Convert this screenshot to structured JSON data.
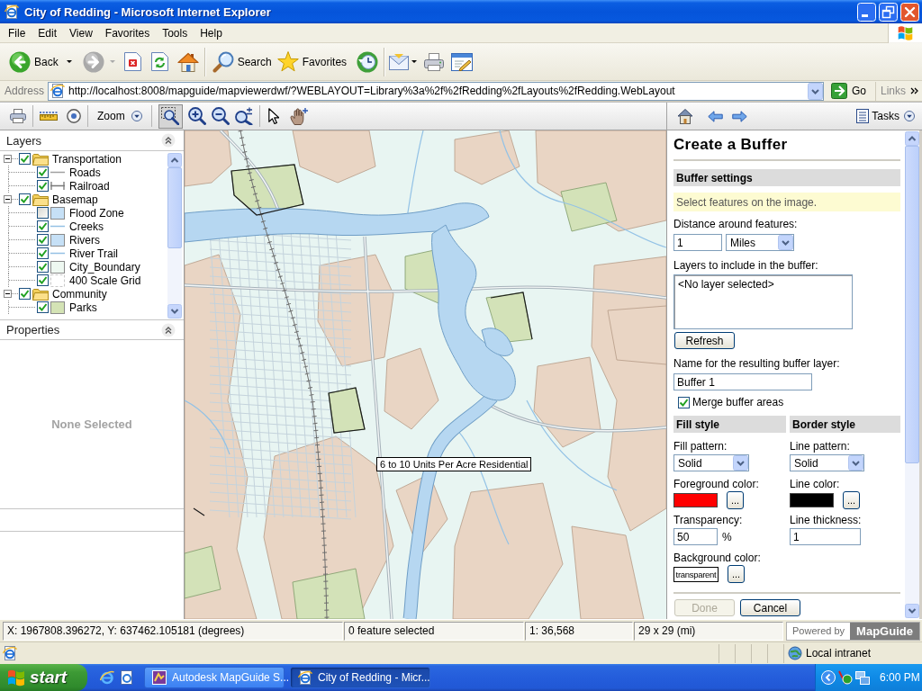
{
  "window": {
    "title": "City of Redding - Microsoft Internet Explorer"
  },
  "menu_bar": [
    "File",
    "Edit",
    "View",
    "Favorites",
    "Tools",
    "Help"
  ],
  "browser_toolbar": {
    "back": "Back",
    "search": "Search",
    "favorites": "Favorites"
  },
  "address_bar": {
    "label": "Address",
    "url": "http://localhost:8008/mapguide/mapviewerdwf/?WEBLAYOUT=Library%3a%2f%2fRedding%2fLayouts%2fRedding.WebLayout",
    "go": "Go",
    "links": "Links"
  },
  "map_toolbar": {
    "zoom_label": "Zoom",
    "zoom_window_selected": true
  },
  "task_toolbar": {
    "tasks_label": "Tasks"
  },
  "layers_panel": {
    "title": "Layers",
    "tree": [
      {
        "label": "Transportation",
        "checked": true,
        "expanded": true,
        "children": [
          {
            "label": "Roads",
            "checked": true,
            "kind": "line",
            "color": "#a0a0a0"
          },
          {
            "label": "Railroad",
            "checked": true,
            "kind": "rail",
            "color": "#7a7a7a"
          }
        ]
      },
      {
        "label": "Basemap",
        "checked": true,
        "expanded": true,
        "children": [
          {
            "label": "Flood Zone",
            "checked": false,
            "kind": "fill",
            "color": "#c6e0f6"
          },
          {
            "label": "Creeks",
            "checked": true,
            "kind": "line",
            "color": "#94c0e4"
          },
          {
            "label": "Rivers",
            "checked": true,
            "kind": "fill",
            "color": "#c6e0f6"
          },
          {
            "label": "River Trail",
            "checked": true,
            "kind": "line",
            "color": "#94c0e4"
          },
          {
            "label": "City_Boundary",
            "checked": true,
            "kind": "fill",
            "color": "#eef8f1"
          },
          {
            "label": "400 Scale Grid",
            "checked": true,
            "kind": "grid",
            "color": "#c8c8c8"
          }
        ]
      },
      {
        "label": "Community",
        "checked": true,
        "expanded": true,
        "children": [
          {
            "label": "Parks",
            "checked": true,
            "kind": "fill",
            "color": "#d4e3b5"
          }
        ]
      }
    ]
  },
  "properties_panel": {
    "title": "Properties",
    "message": "None Selected"
  },
  "map": {
    "tooltip": "6 to 10 Units Per Acre Residential"
  },
  "task_pane": {
    "title": "Create a Buffer",
    "section": "Buffer settings",
    "hint": "Select features on the image.",
    "distance": {
      "label": "Distance around features:",
      "value": "1",
      "unit": "Miles"
    },
    "layers": {
      "label": "Layers to include in the buffer:",
      "items": [
        "<No layer selected>"
      ]
    },
    "refresh": "Refresh",
    "layer_name": {
      "label": "Name for the resulting buffer layer:",
      "value": "Buffer 1"
    },
    "merge": {
      "label": "Merge buffer areas",
      "checked": true
    },
    "fill_style": {
      "heading": "Fill style",
      "pattern_label": "Fill pattern:",
      "pattern": "Solid",
      "color_label": "Foreground color:",
      "color": "#ff0000",
      "picker": "...",
      "transparency_label": "Transparency:",
      "transparency": "50",
      "unit": "%",
      "background_label": "Background color:",
      "background": "transparent",
      "background_picker": "..."
    },
    "border_style": {
      "heading": "Border style",
      "pattern_label": "Line pattern:",
      "pattern": "Solid",
      "color_label": "Line color:",
      "color": "#000000",
      "picker": "...",
      "thickness_label": "Line thickness:",
      "thickness": "1"
    },
    "buttons": [
      {
        "label": "Done",
        "disabled": true
      },
      {
        "label": "Cancel",
        "disabled": false
      }
    ]
  },
  "status_bar": {
    "coordinates": "X: 1967808.396272, Y: 637462.105181 (degrees)",
    "selection": "0 feature selected",
    "scale": "1: 36,568",
    "size": "29 x 29 (mi)",
    "powered_by": "Powered by",
    "brand": "MapGuide"
  },
  "browser_status": {
    "zone": "Local intranet"
  },
  "taskbar": {
    "start": "start",
    "tasks": [
      {
        "label": "Autodesk MapGuide S...",
        "selected": false
      },
      {
        "label": "City of Redding - Micr...",
        "selected": true
      }
    ],
    "clock": "6:00 PM"
  }
}
